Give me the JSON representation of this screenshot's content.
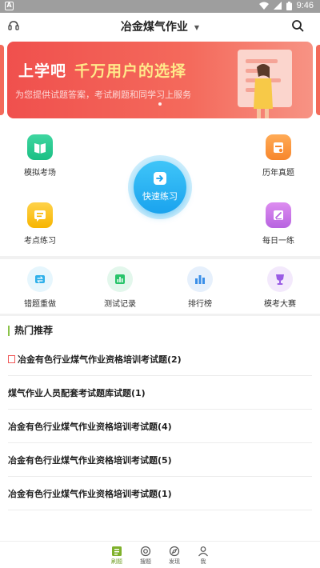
{
  "status_bar": {
    "time": "9:46"
  },
  "app_bar": {
    "title": "冶金煤气作业"
  },
  "banner": {
    "title_main": "上学吧",
    "title_highlight": "千万用户的选择",
    "subtitle": "为您提供试题答案，考试刷题和同学习上服务"
  },
  "features": {
    "mock_exam": "模拟考场",
    "past_papers": "历年真题",
    "topic_practice": "考点练习",
    "daily_one": "每日一练",
    "quick_practice": "快速练习"
  },
  "tools": [
    {
      "label": "错题重做",
      "icon": "retry-icon",
      "color": "#2fb0ea"
    },
    {
      "label": "测试记录",
      "icon": "record-icon",
      "color": "#28c46a"
    },
    {
      "label": "排行榜",
      "icon": "rank-icon",
      "color": "#3a8fe8"
    },
    {
      "label": "模考大赛",
      "icon": "trophy-icon",
      "color": "#9b5de5"
    }
  ],
  "hot": {
    "heading": "热门推荐",
    "items": [
      "冶金有色行业煤气作业资格培训考试题(2)",
      "煤气作业人员配套考试题库试题(1)",
      "冶金有色行业煤气作业资格培训考试题(4)",
      "冶金有色行业煤气作业资格培训考试题(5)",
      "冶金有色行业煤气作业资格培训考试题(1)"
    ]
  },
  "bottom_nav": [
    {
      "label": "刷题",
      "active": true
    },
    {
      "label": "搜题",
      "active": false
    },
    {
      "label": "发现",
      "active": false
    },
    {
      "label": "我",
      "active": false
    }
  ],
  "colors": {
    "accent_green": "#6d9d22",
    "banner_red": "#f0504d",
    "quick_blue": "#1aa3ee"
  }
}
